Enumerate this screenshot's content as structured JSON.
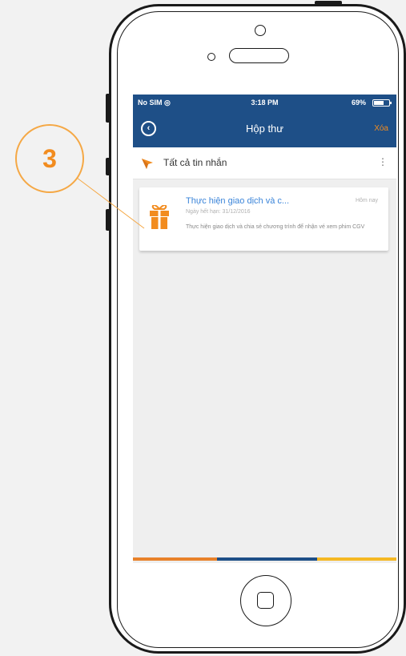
{
  "callout": {
    "number": "3"
  },
  "status_bar": {
    "carrier": "No SIM ◎",
    "time": "3:18 PM",
    "battery": "69%"
  },
  "nav_bar": {
    "back_icon": "chevron-left-circle-icon",
    "title": "Hộp thư",
    "delete_label": "Xóa"
  },
  "filter": {
    "icon": "send-arrow-icon",
    "label": "Tất cả tin nhắn",
    "menu_icon": "more-vertical-icon",
    "menu_glyph": "⋮"
  },
  "messages": [
    {
      "icon": "gift-icon",
      "title": "Thực hiện giao dịch và c...",
      "date": "Hôm nay",
      "expiry": "Ngày hết hạn: 31/12/2016",
      "body": "Thực hiện giao dịch và chia sẻ chương trình để nhận vé xem phim CGV"
    }
  ],
  "colors": {
    "header": "#1e4f87",
    "accent": "#f28c1f",
    "link": "#3a84d9",
    "stripe": [
      "#e8812a",
      "#1e4f87",
      "#f5b823"
    ]
  }
}
